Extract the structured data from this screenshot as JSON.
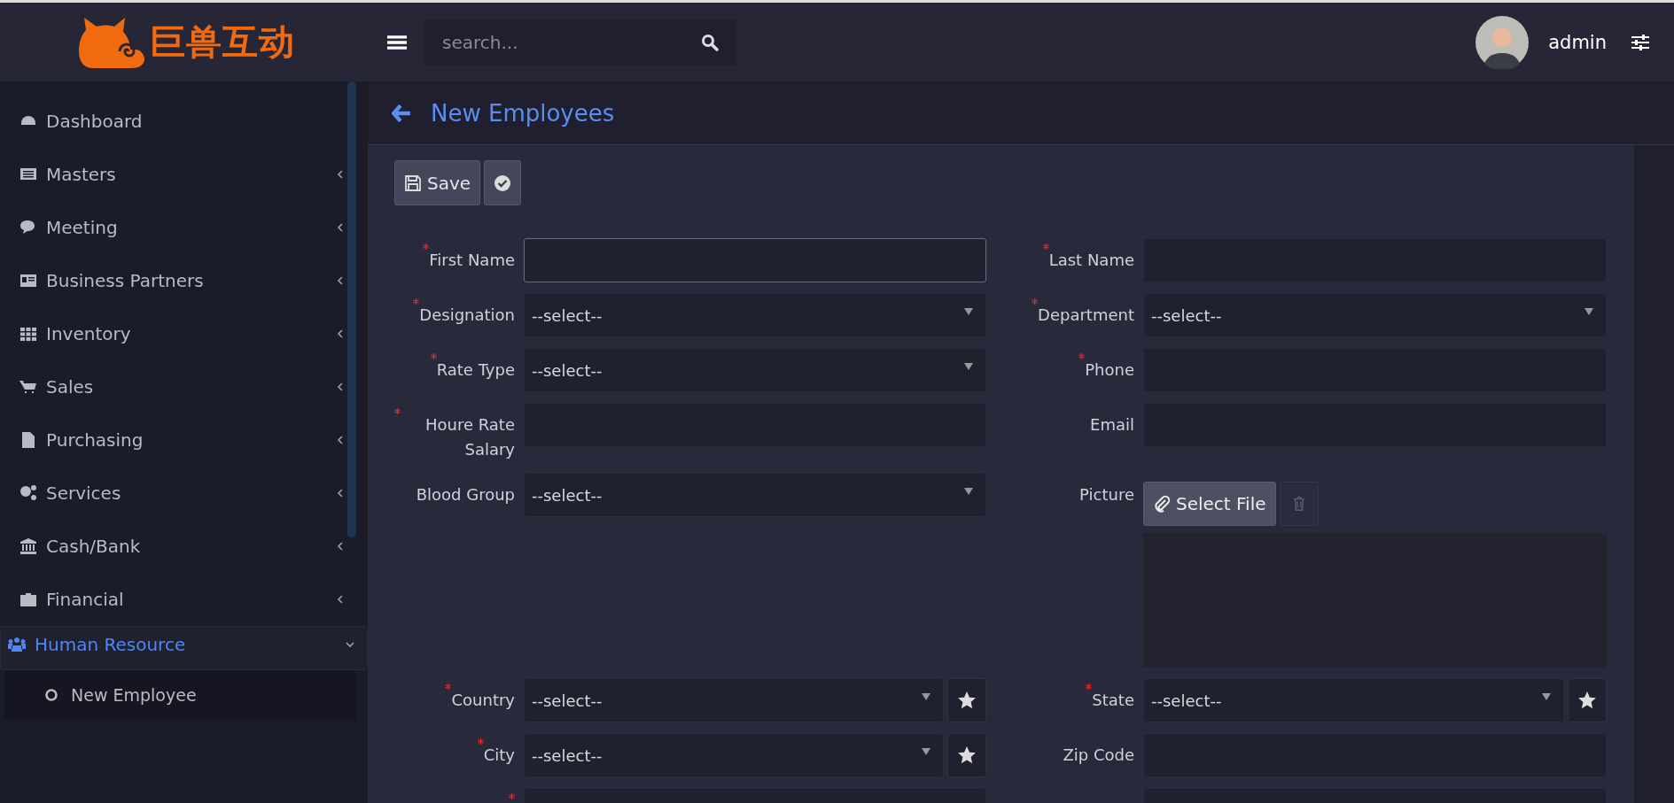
{
  "header": {
    "logo_text": "巨兽互动",
    "search": {
      "placeholder": "search..."
    },
    "user": "admin"
  },
  "sidebar": {
    "items": [
      {
        "label": "Dashboard",
        "kind": "link",
        "selected": false
      },
      {
        "label": "Masters",
        "kind": "group",
        "expanded": false,
        "selected": false
      },
      {
        "label": "Meeting",
        "kind": "group",
        "expanded": false,
        "selected": false
      },
      {
        "label": "Business Partners",
        "kind": "group",
        "expanded": false,
        "selected": false
      },
      {
        "label": "Inventory",
        "kind": "group",
        "expanded": false,
        "selected": false
      },
      {
        "label": "Sales",
        "kind": "group",
        "expanded": false,
        "selected": false
      },
      {
        "label": "Purchasing",
        "kind": "group",
        "expanded": false,
        "selected": false
      },
      {
        "label": "Services",
        "kind": "group",
        "expanded": false,
        "selected": false
      },
      {
        "label": "Cash/Bank",
        "kind": "group",
        "expanded": false,
        "selected": false
      },
      {
        "label": "Financial",
        "kind": "group",
        "expanded": false,
        "selected": false
      },
      {
        "label": "Human Resource",
        "kind": "group",
        "expanded": true,
        "selected": true,
        "children": [
          {
            "label": "New Employee",
            "selected": false
          }
        ]
      }
    ]
  },
  "page": {
    "title": "New Employees"
  },
  "toolbar": {
    "buttons": [
      {
        "kind": "save",
        "label": "Save"
      },
      {
        "kind": "confirm"
      }
    ]
  },
  "form": {
    "rows": [
      {
        "left": {
          "label": "First Name",
          "required": true,
          "kind": "text",
          "focused": true
        },
        "right": {
          "label": "Last Name",
          "required": true,
          "kind": "text",
          "focused": false
        }
      },
      {
        "left": {
          "label": "Designation",
          "required": true,
          "kind": "select",
          "value": "--select--",
          "favorite": false
        },
        "right": {
          "label": "Department",
          "required": true,
          "kind": "select",
          "value": "--select--",
          "favorite": false
        }
      },
      {
        "left": {
          "label": "Rate Type",
          "required": true,
          "kind": "select",
          "value": "--select--",
          "favorite": false
        },
        "right": {
          "label": "Phone",
          "required": true,
          "kind": "text",
          "focused": false
        }
      },
      {
        "left": {
          "label": "Houre Rate Salary",
          "required": true,
          "kind": "text",
          "focused": false
        },
        "right": {
          "label": "Email",
          "required": false,
          "kind": "text",
          "focused": false
        }
      },
      {
        "left": {
          "label": "Blood Group",
          "required": false,
          "kind": "select",
          "value": "--select--",
          "favorite": false
        },
        "right": {
          "label": "Picture",
          "required": false,
          "kind": "file",
          "button": "Select File"
        }
      },
      {
        "left": {
          "label": "Country",
          "required": true,
          "kind": "select",
          "value": "--select--",
          "favorite": true
        },
        "right": {
          "label": "State",
          "required": true,
          "kind": "select",
          "value": "--select--",
          "favorite": true
        }
      },
      {
        "left": {
          "label": "City",
          "required": true,
          "kind": "select",
          "value": "--select--",
          "favorite": true
        },
        "right": {
          "label": "Zip Code",
          "required": false,
          "kind": "text",
          "focused": false
        }
      },
      {
        "left": {
          "required": true,
          "kind": "text",
          "focused": false
        },
        "right": {
          "required": false,
          "kind": "text",
          "focused": false
        }
      }
    ]
  }
}
